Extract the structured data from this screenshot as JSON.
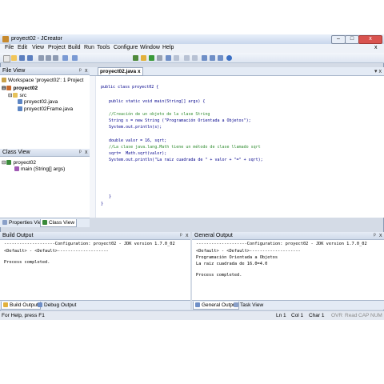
{
  "window": {
    "title": "proyect02 - JCreator"
  },
  "menu": [
    "File",
    "Edit",
    "View",
    "Project",
    "Build",
    "Run",
    "Tools",
    "Configure",
    "Window",
    "Help"
  ],
  "file_view": {
    "title": "File View",
    "tree": [
      "Workspace 'proyect02': 1 Project",
      "proyect02",
      "src",
      "proyect02.java",
      "proyect02Frame.java"
    ]
  },
  "class_view": {
    "title": "Class View",
    "tree": [
      "proyect02",
      "main (String[] args)"
    ]
  },
  "left_tabs": [
    "Properties View",
    "Class View"
  ],
  "editor": {
    "tab": "proyect02.java",
    "lines": [
      "public class proyect02 {",
      "public static void main(String[] args) {",
      "//Creación de un objeto de la clase String",
      "String s = new String (\"Programación Orientada a Objetos\");",
      "System.out.println(s);",
      "double valor = 16, sqrt;",
      "//La clase java.lang.Math tiene un método de clase llamado sqrt",
      "sqrt=  Math.sqrt(valor);",
      "System.out.println(\"La raiz cuadrada de \" + valor + \"=\" + sqrt);",
      "}",
      "}"
    ]
  },
  "build_output": {
    "title": "Build Output",
    "lines": [
      "--------------------Configuration: proyect02 - JDK version 1.7.0_02",
      "<Default> - <Default>--------------------",
      "",
      "Process completed."
    ]
  },
  "general_output": {
    "title": "General Output",
    "lines": [
      "--------------------Configuration: proyect02 - JDK version 1.7.0_02",
      "<Default> - <Default>--------------------",
      "Programación Orientada a Objetos",
      "La raiz cuadrada de 16.0=4.0",
      "",
      "Process completed."
    ]
  },
  "bottom_tabs_left": [
    "Build Output",
    "Debug Output"
  ],
  "bottom_tabs_right": [
    "General Output",
    "Task View"
  ],
  "status": {
    "help": "For Help, press F1",
    "ln": "Ln 1",
    "col": "Col 1",
    "char": "Char 1",
    "ovr": "OVR",
    "read": "Read",
    "cap": "CAP",
    "num": "NUM"
  }
}
